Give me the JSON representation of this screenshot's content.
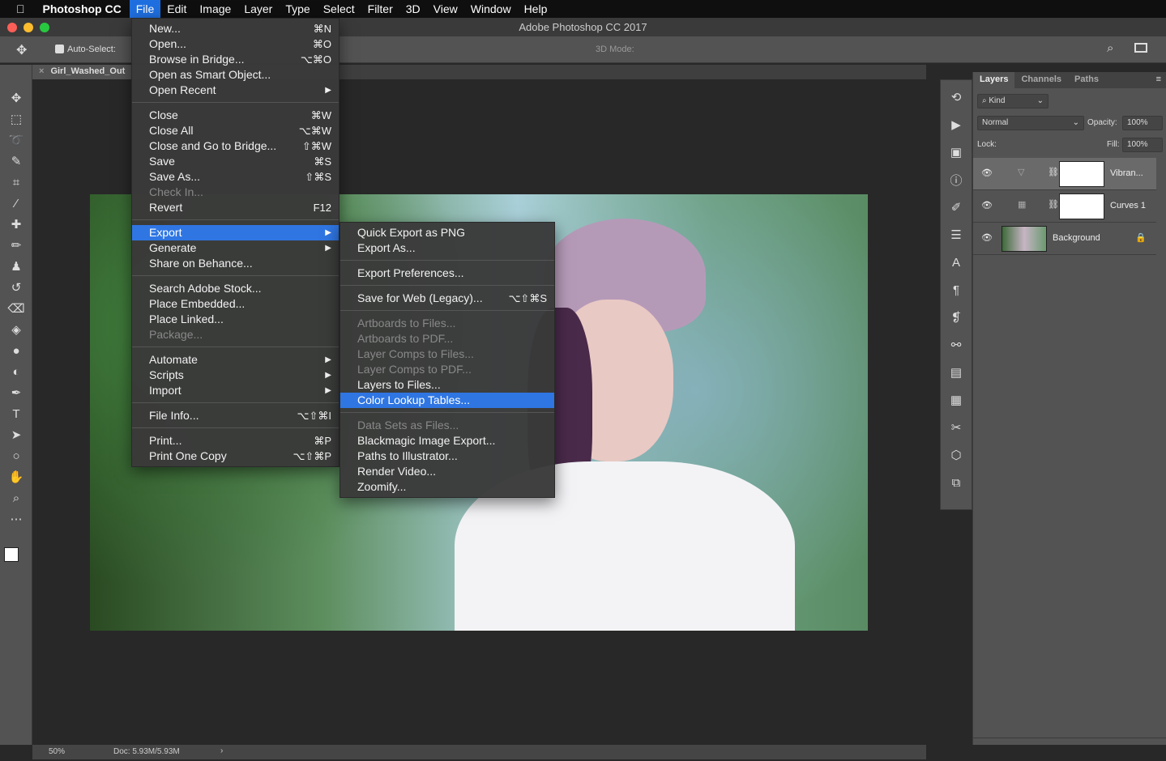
{
  "menubar": {
    "app": "Photoshop CC",
    "items": [
      "File",
      "Edit",
      "Image",
      "Layer",
      "Type",
      "Select",
      "Filter",
      "3D",
      "View",
      "Window",
      "Help"
    ]
  },
  "window": {
    "title": "Adobe Photoshop CC 2017"
  },
  "options": {
    "auto_select": "Auto-Select:",
    "mode_3d": "3D Mode:"
  },
  "document": {
    "tab": "Girl_Washed_Out",
    "zoom": "50%",
    "doc_size": "Doc: 5.93M/5.93M"
  },
  "file_menu": [
    [
      {
        "label": "New...",
        "sc": "⌘N"
      },
      {
        "label": "Open...",
        "sc": "⌘O"
      },
      {
        "label": "Browse in Bridge...",
        "sc": "⌥⌘O"
      },
      {
        "label": "Open as Smart Object..."
      },
      {
        "label": "Open Recent",
        "sub": true
      }
    ],
    [
      {
        "label": "Close",
        "sc": "⌘W"
      },
      {
        "label": "Close All",
        "sc": "⌥⌘W"
      },
      {
        "label": "Close and Go to Bridge...",
        "sc": "⇧⌘W"
      },
      {
        "label": "Save",
        "sc": "⌘S"
      },
      {
        "label": "Save As...",
        "sc": "⇧⌘S"
      },
      {
        "label": "Check In...",
        "dis": true
      },
      {
        "label": "Revert",
        "sc": "F12"
      }
    ],
    [
      {
        "label": "Export",
        "sub": true,
        "hl": true
      },
      {
        "label": "Generate",
        "sub": true
      },
      {
        "label": "Share on Behance..."
      }
    ],
    [
      {
        "label": "Search Adobe Stock..."
      },
      {
        "label": "Place Embedded..."
      },
      {
        "label": "Place Linked..."
      },
      {
        "label": "Package...",
        "dis": true
      }
    ],
    [
      {
        "label": "Automate",
        "sub": true
      },
      {
        "label": "Scripts",
        "sub": true
      },
      {
        "label": "Import",
        "sub": true
      }
    ],
    [
      {
        "label": "File Info...",
        "sc": "⌥⇧⌘I"
      }
    ],
    [
      {
        "label": "Print...",
        "sc": "⌘P"
      },
      {
        "label": "Print One Copy",
        "sc": "⌥⇧⌘P"
      }
    ]
  ],
  "export_menu": [
    [
      {
        "label": "Quick Export as PNG"
      },
      {
        "label": "Export As..."
      }
    ],
    [
      {
        "label": "Export Preferences..."
      }
    ],
    [
      {
        "label": "Save for Web (Legacy)...",
        "sc": "⌥⇧⌘S"
      }
    ],
    [
      {
        "label": "Artboards to Files...",
        "dis": true
      },
      {
        "label": "Artboards to PDF...",
        "dis": true
      },
      {
        "label": "Layer Comps to Files...",
        "dis": true
      },
      {
        "label": "Layer Comps to PDF...",
        "dis": true
      },
      {
        "label": "Layers to Files..."
      },
      {
        "label": "Color Lookup Tables...",
        "hl": true
      }
    ],
    [
      {
        "label": "Data Sets as Files...",
        "dis": true
      },
      {
        "label": "Blackmagic Image Export..."
      },
      {
        "label": "Paths to Illustrator..."
      },
      {
        "label": "Render Video..."
      },
      {
        "label": "Zoomify..."
      }
    ]
  ],
  "layers_panel": {
    "tabs": [
      "Layers",
      "Channels",
      "Paths"
    ],
    "filter": "Kind",
    "blend_mode": "Normal",
    "opacity_label": "Opacity:",
    "opacity": "100%",
    "lock_label": "Lock:",
    "fill_label": "Fill:",
    "fill": "100%",
    "layers": [
      {
        "name": "Vibran...",
        "selected": true
      },
      {
        "name": "Curves 1"
      },
      {
        "name": "Background",
        "locked": true
      }
    ]
  },
  "colors": {
    "accent": "#2f76e3",
    "panel": "#535353",
    "canvas": "#282828"
  }
}
